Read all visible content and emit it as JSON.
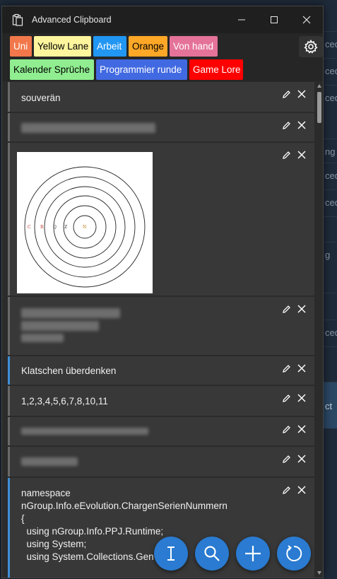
{
  "background_app": {
    "rows": [
      "ced",
      "ced",
      "ced",
      "ng",
      "ced",
      "ced",
      "",
      "g",
      "",
      "ced",
      "",
      "ct"
    ]
  },
  "window": {
    "title": "Advanced Clipboard",
    "app_icon": "clipboard-icon"
  },
  "tags": [
    {
      "label": "Uni",
      "bg": "#f2784b",
      "fg": "#ffffff"
    },
    {
      "label": "Yellow Lane",
      "bg": "#fff59d",
      "fg": "#000000"
    },
    {
      "label": "Arbeit",
      "bg": "#2196f3",
      "fg": "#ffffff"
    },
    {
      "label": "Orange",
      "bg": "#ffa726",
      "fg": "#000000"
    },
    {
      "label": "Von hand",
      "bg": "#e57399",
      "fg": "#ffffff"
    },
    {
      "label": "Kalender Sprüche",
      "bg": "#90ee90",
      "fg": "#000000"
    },
    {
      "label": "Programmier runde",
      "bg": "#4169e1",
      "fg": "#ffffff"
    },
    {
      "label": "Game Lore",
      "bg": "#ff0000",
      "fg": "#ffffff"
    }
  ],
  "items": [
    {
      "text": "souverän"
    },
    {
      "text": ""
    },
    {
      "text": "",
      "image": {
        "labels": [
          "C",
          "R",
          "Q",
          "Z",
          "N"
        ]
      }
    },
    {
      "text": ""
    },
    {
      "text": "Klatschen überdenken"
    },
    {
      "text": "1,2,3,4,5,6,7,8,10,11"
    },
    {
      "text": ""
    },
    {
      "text": ""
    },
    {
      "text": "namespace\nnGroup.Info.eEvolution.ChargenSerienNummern\n{\n  using nGroup.Info.PPJ.Runtime;\n  using System;\n  using System.Collections.Gen"
    }
  ],
  "icons": {
    "edit": "pencil-icon",
    "delete": "close-icon",
    "settings": "gear-icon",
    "fab1": "text-cursor-icon",
    "fab2": "search-icon",
    "fab3": "plus-icon",
    "fab4": "refresh-icon"
  },
  "colors": {
    "accent": "#2a7bd1",
    "item_bg": "#383838",
    "window_bg": "#2b2b2b"
  }
}
